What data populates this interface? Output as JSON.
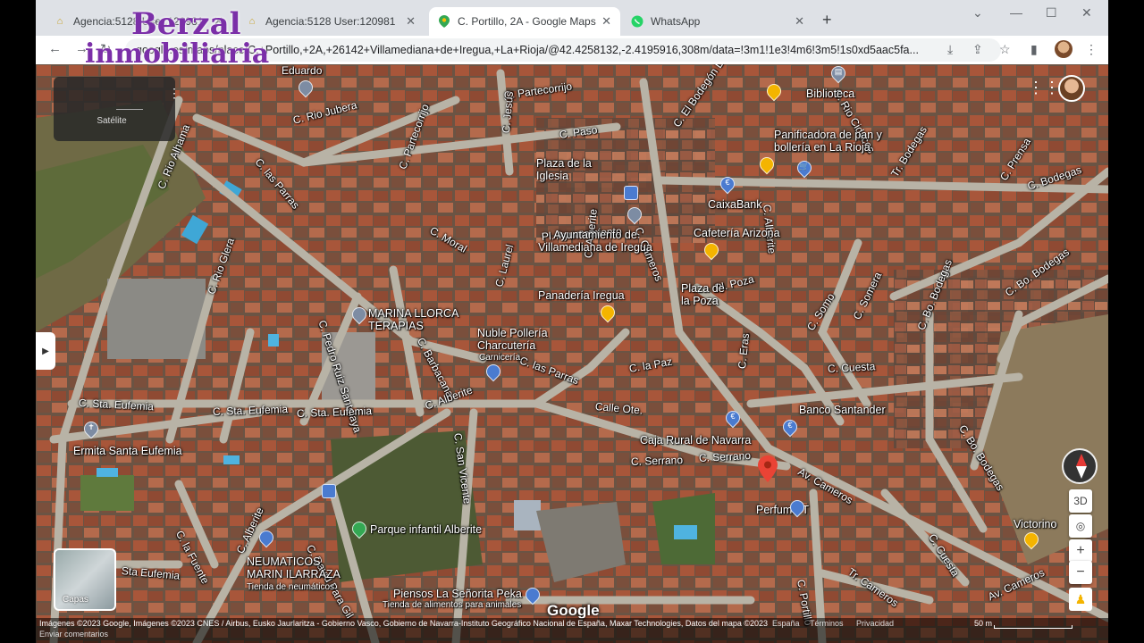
{
  "watermark": {
    "line1": "Berzal",
    "line2": "inmobiliaria"
  },
  "tabs": [
    {
      "title": "Agencia:5128 User:120981",
      "favicon": "house-icon",
      "active": false
    },
    {
      "title": "Agencia:5128 User:120981",
      "favicon": "house-icon",
      "active": false
    },
    {
      "title": "C. Portillo, 2A - Google Maps",
      "favicon": "maps-pin-icon",
      "active": true
    },
    {
      "title": "WhatsApp",
      "favicon": "whatsapp-icon",
      "active": false
    }
  ],
  "toolbar": {
    "url": "google.es/maps/place/C.+Portillo,+2A,+26142+Villamediana+de+Iregua,+La+Rioja/@42.4258132,-2.4195916,308m/data=!3m1!1e3!4m6!3m5!1s0xd5aac5fa..."
  },
  "map_type": {
    "label": "Satélite"
  },
  "layers": {
    "label": "Capas"
  },
  "controls": {
    "view_3d": "3D",
    "zoom_in": "+",
    "zoom_out": "−"
  },
  "google_logo": "Google",
  "attribution": {
    "text": "Imágenes ©2023 Google, Imágenes ©2023 CNES / Airbus, Eusko Jaurlaritza - Gobierno Vasco, Gobierno de Navarra-Instituto Geográfico Nacional de España, Maxar Technologies, Datos del mapa ©2023",
    "country": "España",
    "terms": "Términos",
    "privacy": "Privacidad",
    "scale": "50 m",
    "feedback": "Enviar comentarios"
  },
  "streets": {
    "s1": "Eduardo",
    "s2": "C. Rio Jubera",
    "s3": "C. Partecorrijo",
    "s4": "C. Jesús",
    "s5": "C. Partecorrijo",
    "s6": "C. Paso",
    "s7": "C. El Bodegón Del Fraile",
    "s8": "C. Rio Alhama",
    "s9": "C. las Parras",
    "s10": "C. Moral",
    "s11": "C. Rio Cidacos",
    "s12": "C. Rio Glera",
    "s13": "C. Pedro Ruiz Santolaya",
    "s14": "C. Laurel",
    "s15": "C. Barbacana",
    "s16": "C. Alberite",
    "s17": "Pl. Poza",
    "s18": "C. Somo",
    "s19": "C. Somera",
    "s20": "C. Bo. Bodegas",
    "s21": "C. Bodegas",
    "s22": "C. Bo. Bodegas",
    "s23": "Tr. Bodegas",
    "s24": "C. Prensa",
    "s25": "C. Cuesta",
    "s26": "C. Eras",
    "s27": "C. la Paz",
    "s28": "Calle Ote.",
    "s29": "C. Sta. Eufemia",
    "s30": "C. Sta. Eufemia",
    "s31": "C. Sta. Eufemia",
    "s32": "C. Alberite",
    "s33": "C. San Vicente",
    "s34": "C. Serrano",
    "s35": "C. Serrano",
    "s36": "Av. Cameros",
    "s37": "Av. Cameros",
    "s38": "C. Portillo",
    "s39": "C. Cuesta",
    "s40": "Tr. Cameros",
    "s41": "C. Bo. Bodegas",
    "s42": "C. Alberite",
    "s43": "C. David Para Gil",
    "s44": "C. la Fuente",
    "s45": "Sta Eufemia",
    "s46": "Pl. Ayuntamiento",
    "s47": "C. Cameros",
    "s48": "C. Alberite",
    "s49": "C. Eras",
    "s50": "C. las Parras",
    "s51": "C. Cameros"
  },
  "places": {
    "p1": "Biblioteca",
    "p2": "Panificadora de pan y bollería en La Rioja",
    "p3": "Plaza de la Iglesia",
    "p4": "CaixaBank",
    "p5": "Ayuntamiento de Villamediana de Iregua",
    "p6": "Cafetería Arizona",
    "p7": "Panadería Iregua",
    "p8": "Plaza de la Poza",
    "p9": "MARINA LLORCA TERAPIAS",
    "p10": "Nuble Pollería Charcutería",
    "p10b": "Carnicería",
    "p11": "Banco Santander",
    "p12": "Caja Rural de Navarra",
    "p13": "Perfuma-T",
    "p14": "Ermita Santa Eufemia",
    "p15": "Parque infantil Alberite",
    "p16": "NEUMATICOS MARIN ILARRAZA",
    "p16b": "Tienda de neumáticos",
    "p17": "Piensos La Señorita Peka",
    "p17b": "Tienda de alimentos para animales",
    "p18": "Victorino"
  },
  "colors": {
    "accent_red": "#ea4335",
    "pin_yellow": "#f4b400",
    "pin_blue": "#4a7bd0",
    "pin_gray": "#7d8ca3",
    "pin_green": "#34a853",
    "watermark_purple": "#7b2fa8"
  }
}
